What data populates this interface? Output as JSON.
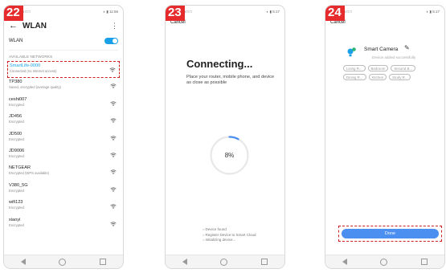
{
  "steps": [
    "22",
    "23",
    "24"
  ],
  "status_bar": {
    "left": "■ □ □",
    "right1": "◐ ▮ 11:56",
    "right2": "◐ ▮ 5:17",
    "right3": "◐ ▮ 5:17"
  },
  "screen1": {
    "title": "WLAN",
    "back_icon": "←",
    "menu_icon": "⋮",
    "wlan_label": "WLAN",
    "section": "AVAILABLE NETWORKS",
    "networks": [
      {
        "name": "SmartLife-0000",
        "status": "Connected (no Internet access)"
      },
      {
        "name": "TP380",
        "status": "Saved, encrypted (average quality)"
      },
      {
        "name": "ceshi007",
        "status": "Encrypted"
      },
      {
        "name": "JD456",
        "status": "Encrypted"
      },
      {
        "name": "JD500",
        "status": "Encrypted"
      },
      {
        "name": "JD9006",
        "status": "Encrypted"
      },
      {
        "name": "NETGEAR",
        "status": "Encrypted (WPS available)"
      },
      {
        "name": "V380_5G",
        "status": "Encrypted"
      },
      {
        "name": "wifi123",
        "status": "Encrypted"
      },
      {
        "name": "xiaoyi",
        "status": "Encrypted"
      }
    ]
  },
  "screen2": {
    "cancel": "Cancel",
    "title": "Connecting...",
    "subtitle": "Place your router, mobile phone, and device as close as possible",
    "progress_text": "8%",
    "progress_fraction": 0.08,
    "steps": [
      "Device found",
      "Register Device to Smart Cloud",
      "Initializing device..."
    ]
  },
  "screen3": {
    "cancel": "Cancel",
    "device_name": "Smart Camera",
    "edit_icon": "✎",
    "subtitle": "Device added successfully",
    "rooms": [
      "Living R...",
      "Bedroom",
      "Second B...",
      "Dining R...",
      "Kitchen",
      "Study R..."
    ],
    "done": "Done"
  },
  "colors": {
    "accent": "#1aa0e6",
    "highlight": "#cc1f1f",
    "button": "#4b8ff0",
    "step_badge": "#e52b2b"
  }
}
